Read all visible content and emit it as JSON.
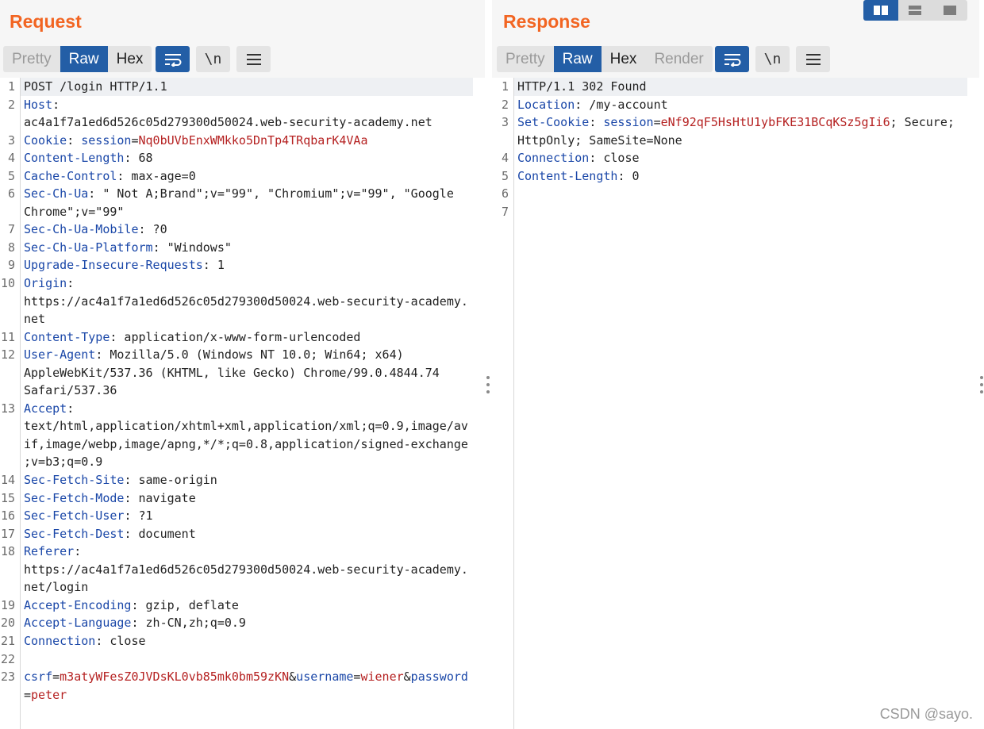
{
  "request": {
    "title": "Request",
    "tabs": [
      "Pretty",
      "Raw",
      "Hex"
    ],
    "active_tab": "Raw",
    "toolbar_icons": [
      "wrap-lines-icon",
      "newline-icon",
      "menu-icon"
    ],
    "lines": [
      {
        "n": "1",
        "parts": [
          {
            "t": "POST /login HTTP/1.1",
            "c": "v"
          }
        ]
      },
      {
        "n": "2",
        "parts": [
          {
            "t": "Host",
            "c": "k"
          },
          {
            "t": ":\nac4a1f7a1ed6d526c05d279300d50024.web-security-academy.net",
            "c": "v"
          }
        ]
      },
      {
        "n": "3",
        "parts": [
          {
            "t": "Cookie",
            "c": "k"
          },
          {
            "t": ": ",
            "c": "v"
          },
          {
            "t": "session",
            "c": "k"
          },
          {
            "t": "=",
            "c": "v"
          },
          {
            "t": "Nq0bUVbEnxWMkko5DnTp4TRqbarK4VAa",
            "c": "sv"
          }
        ]
      },
      {
        "n": "4",
        "parts": [
          {
            "t": "Content-Length",
            "c": "k"
          },
          {
            "t": ": 68",
            "c": "v"
          }
        ]
      },
      {
        "n": "5",
        "parts": [
          {
            "t": "Cache-Control",
            "c": "k"
          },
          {
            "t": ": max-age=0",
            "c": "v"
          }
        ]
      },
      {
        "n": "6",
        "parts": [
          {
            "t": "Sec-Ch-Ua",
            "c": "k"
          },
          {
            "t": ": \" Not A;Brand\";v=\"99\", \"Chromium\";v=\"99\", \"Google\nChrome\";v=\"99\"",
            "c": "v"
          }
        ]
      },
      {
        "n": "7",
        "parts": [
          {
            "t": "Sec-Ch-Ua-Mobile",
            "c": "k"
          },
          {
            "t": ": ?0",
            "c": "v"
          }
        ]
      },
      {
        "n": "8",
        "parts": [
          {
            "t": "Sec-Ch-Ua-Platform",
            "c": "k"
          },
          {
            "t": ": \"Windows\"",
            "c": "v"
          }
        ]
      },
      {
        "n": "9",
        "parts": [
          {
            "t": "Upgrade-Insecure-Requests",
            "c": "k"
          },
          {
            "t": ": 1",
            "c": "v"
          }
        ]
      },
      {
        "n": "10",
        "parts": [
          {
            "t": "Origin",
            "c": "k"
          },
          {
            "t": ":\nhttps://ac4a1f7a1ed6d526c05d279300d50024.web-security-academy.\nnet",
            "c": "v"
          }
        ]
      },
      {
        "n": "11",
        "parts": [
          {
            "t": "Content-Type",
            "c": "k"
          },
          {
            "t": ": application/x-www-form-urlencoded",
            "c": "v"
          }
        ]
      },
      {
        "n": "12",
        "parts": [
          {
            "t": "User-Agent",
            "c": "k"
          },
          {
            "t": ": Mozilla/5.0 (Windows NT 10.0; Win64; x64)\nAppleWebKit/537.36 (KHTML, like Gecko) Chrome/99.0.4844.74\nSafari/537.36",
            "c": "v"
          }
        ]
      },
      {
        "n": "13",
        "parts": [
          {
            "t": "Accept",
            "c": "k"
          },
          {
            "t": ":\ntext/html,application/xhtml+xml,application/xml;q=0.9,image/av\nif,image/webp,image/apng,*/*;q=0.8,application/signed-exchange\n;v=b3;q=0.9",
            "c": "v"
          }
        ]
      },
      {
        "n": "14",
        "parts": [
          {
            "t": "Sec-Fetch-Site",
            "c": "k"
          },
          {
            "t": ": same-origin",
            "c": "v"
          }
        ]
      },
      {
        "n": "15",
        "parts": [
          {
            "t": "Sec-Fetch-Mode",
            "c": "k"
          },
          {
            "t": ": navigate",
            "c": "v"
          }
        ]
      },
      {
        "n": "16",
        "parts": [
          {
            "t": "Sec-Fetch-User",
            "c": "k"
          },
          {
            "t": ": ?1",
            "c": "v"
          }
        ]
      },
      {
        "n": "17",
        "parts": [
          {
            "t": "Sec-Fetch-Dest",
            "c": "k"
          },
          {
            "t": ": document",
            "c": "v"
          }
        ]
      },
      {
        "n": "18",
        "parts": [
          {
            "t": "Referer",
            "c": "k"
          },
          {
            "t": ":\nhttps://ac4a1f7a1ed6d526c05d279300d50024.web-security-academy.\nnet/login",
            "c": "v"
          }
        ]
      },
      {
        "n": "19",
        "parts": [
          {
            "t": "Accept-Encoding",
            "c": "k"
          },
          {
            "t": ": gzip, deflate",
            "c": "v"
          }
        ]
      },
      {
        "n": "20",
        "parts": [
          {
            "t": "Accept-Language",
            "c": "k"
          },
          {
            "t": ": zh-CN,zh;q=0.9",
            "c": "v"
          }
        ]
      },
      {
        "n": "21",
        "parts": [
          {
            "t": "Connection",
            "c": "k"
          },
          {
            "t": ": close",
            "c": "v"
          }
        ]
      },
      {
        "n": "22",
        "parts": [
          {
            "t": "",
            "c": "v"
          }
        ]
      },
      {
        "n": "23",
        "parts": [
          {
            "t": "csrf",
            "c": "k"
          },
          {
            "t": "=",
            "c": "v"
          },
          {
            "t": "m3atyWFesZ0JVDsKL0vb85mk0bm59zKN",
            "c": "sv"
          },
          {
            "t": "&",
            "c": "v"
          },
          {
            "t": "username",
            "c": "k"
          },
          {
            "t": "=",
            "c": "v"
          },
          {
            "t": "wiener",
            "c": "sv"
          },
          {
            "t": "&",
            "c": "v"
          },
          {
            "t": "password",
            "c": "k"
          },
          {
            "t": "\n=",
            "c": "v"
          },
          {
            "t": "peter",
            "c": "sv"
          }
        ]
      }
    ]
  },
  "response": {
    "title": "Response",
    "tabs": [
      "Pretty",
      "Raw",
      "Hex",
      "Render"
    ],
    "active_tab": "Raw",
    "toolbar_icons": [
      "wrap-lines-icon",
      "newline-icon",
      "menu-icon"
    ],
    "lines": [
      {
        "n": "1",
        "parts": [
          {
            "t": "HTTP/1.1 302 Found",
            "c": "v"
          }
        ]
      },
      {
        "n": "2",
        "parts": [
          {
            "t": "Location",
            "c": "k"
          },
          {
            "t": ": /my-account",
            "c": "v"
          }
        ]
      },
      {
        "n": "3",
        "parts": [
          {
            "t": "Set-Cookie",
            "c": "k"
          },
          {
            "t": ": ",
            "c": "v"
          },
          {
            "t": "session",
            "c": "k"
          },
          {
            "t": "=",
            "c": "v"
          },
          {
            "t": "eNf92qF5HsHtU1ybFKE31BCqKSz5gIi6",
            "c": "sv"
          },
          {
            "t": "; Secure;\nHttpOnly; SameSite=None",
            "c": "v"
          }
        ]
      },
      {
        "n": "4",
        "parts": [
          {
            "t": "Connection",
            "c": "k"
          },
          {
            "t": ": close",
            "c": "v"
          }
        ]
      },
      {
        "n": "5",
        "parts": [
          {
            "t": "Content-Length",
            "c": "k"
          },
          {
            "t": ": 0",
            "c": "v"
          }
        ]
      },
      {
        "n": "6",
        "parts": [
          {
            "t": "",
            "c": "v"
          }
        ]
      },
      {
        "n": "7",
        "parts": [
          {
            "t": "",
            "c": "v"
          }
        ]
      }
    ]
  },
  "layout_toggle": {
    "options": [
      "side-by-side-icon",
      "stacked-icon",
      "single-pane-icon"
    ],
    "active": "side-by-side-icon"
  },
  "watermark": "CSDN @sayo.",
  "colors": {
    "title_orange": "#f26522",
    "active_blue": "#235ea6",
    "key_blue": "#1a47a8",
    "value_red": "#b52121"
  }
}
